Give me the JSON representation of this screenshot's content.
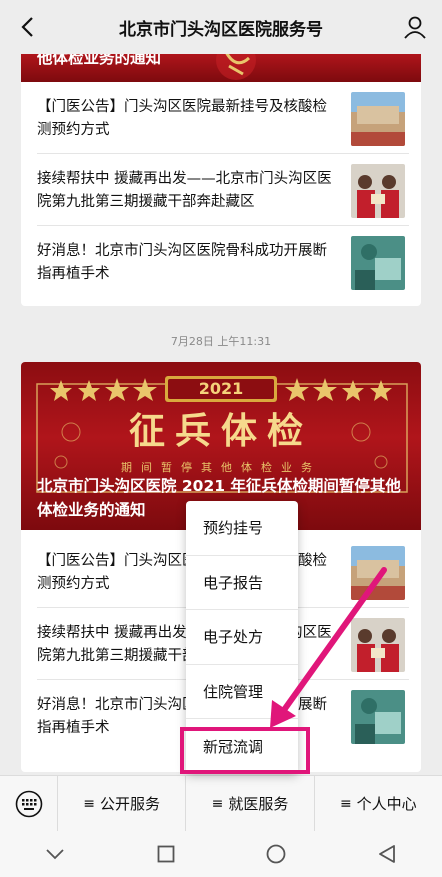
{
  "header": {
    "title": "北京市门头沟区医院服务号"
  },
  "card1": {
    "banner_title": "他体检业务的通知",
    "items": [
      {
        "text": "【门医公告】门头沟区医院最新挂号及核酸检测预约方式"
      },
      {
        "text": "接续帮扶中 援藏再出发——北京市门头沟区医院第九批第三期援藏干部奔赴藏区"
      },
      {
        "text": "好消息！北京市门头沟区医院骨科成功开展断指再植手术"
      }
    ]
  },
  "timestamp": "7月28日 上午11:31",
  "card2": {
    "banner_year": "2021",
    "banner_headline": "征兵体检",
    "banner_subline": "期间暂停其他体检业务",
    "banner_title": "北京市门头沟区医院 2021 年征兵体检期间暂停其他体检业务的通知",
    "items": [
      {
        "text": "【门医公告】门头沟区医院最新挂号及核酸检测预约方式"
      },
      {
        "text": "接续帮扶中 援藏再出发——北京市门头沟区医院第九批第三期援藏干部奔赴藏区"
      },
      {
        "text": "好消息！北京市门头沟区医院骨科成功开展断指再植手术"
      }
    ]
  },
  "popup_menu": {
    "items": [
      "预约挂号",
      "电子报告",
      "电子处方",
      "住院管理",
      "新冠流调"
    ]
  },
  "bottom_menu": {
    "items": [
      "公开服务",
      "就医服务",
      "个人中心"
    ]
  },
  "icons": {
    "back": "back-arrow-icon",
    "user": "user-icon",
    "keyboard": "keyboard-icon",
    "nav": [
      "nav-back-down-icon",
      "nav-recents-icon",
      "nav-home-icon",
      "nav-back-icon"
    ]
  },
  "colors": {
    "highlight": "#e0167a",
    "banner_red": "#a8141a",
    "gold": "#e9c56b"
  }
}
